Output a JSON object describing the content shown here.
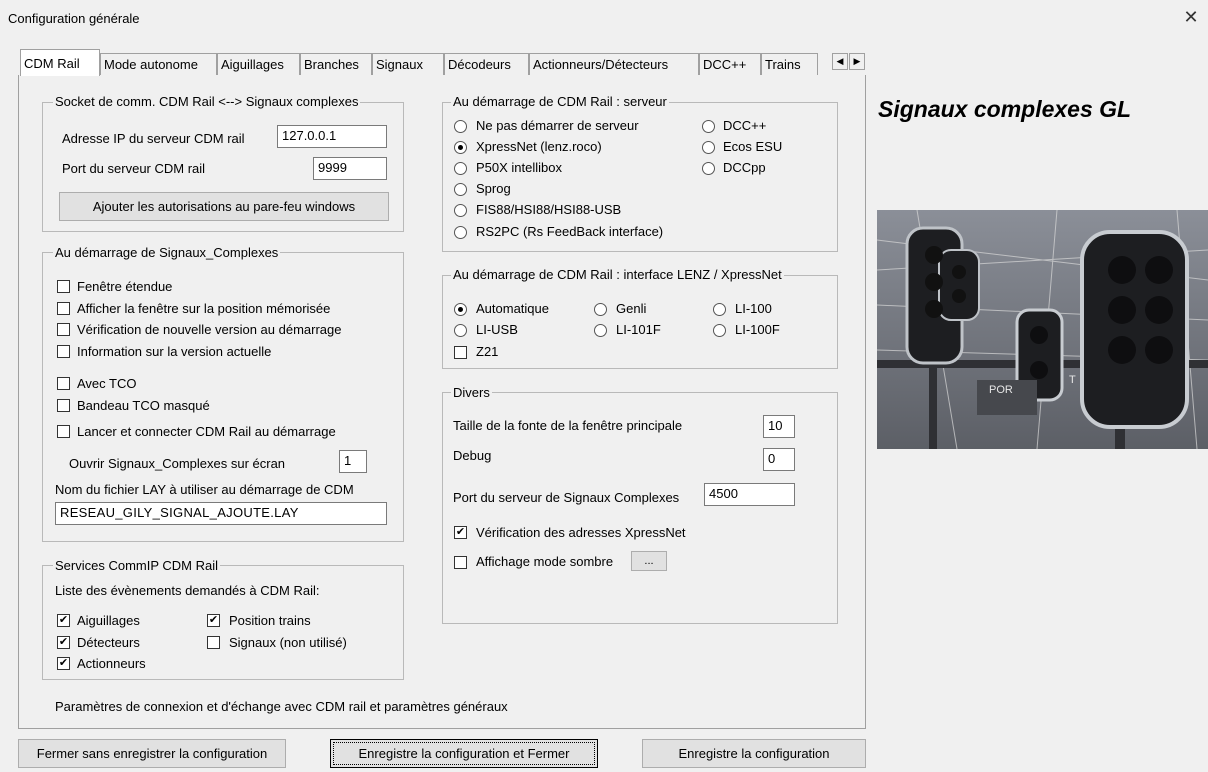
{
  "window": {
    "title": "Configuration générale",
    "close_icon": "close-icon"
  },
  "tabs": [
    {
      "label": "CDM Rail"
    },
    {
      "label": "Mode autonome"
    },
    {
      "label": "Aiguillages"
    },
    {
      "label": "Branches"
    },
    {
      "label": "Signaux"
    },
    {
      "label": "Décodeurs"
    },
    {
      "label": "Actionneurs/Détecteurs"
    },
    {
      "label": "DCC++"
    },
    {
      "label": "Trains"
    }
  ],
  "tab_scroll": {
    "left_icon": "arrow-left-icon",
    "right_icon": "arrow-right-icon"
  },
  "socket": {
    "legend": "Socket de comm. CDM Rail <--> Signaux complexes",
    "ip_label": "Adresse IP du serveur CDM rail",
    "ip_value": "127.0.0.1",
    "port_label": "Port du serveur CDM rail",
    "port_value": "9999",
    "firewall_button": "Ajouter les autorisations au pare-feu windows"
  },
  "startup_sc": {
    "legend": "Au démarrage de Signaux_Complexes",
    "options": [
      {
        "label": "Fenêtre étendue",
        "checked": false
      },
      {
        "label": "Afficher la fenêtre sur la position mémorisée",
        "checked": false
      },
      {
        "label": "Vérification de nouvelle version au démarrage",
        "checked": false
      },
      {
        "label": "Information sur la version actuelle",
        "checked": false
      },
      {
        "label": "Avec TCO",
        "checked": false
      },
      {
        "label": "Bandeau TCO masqué",
        "checked": false
      },
      {
        "label": "Lancer et connecter CDM Rail au démarrage",
        "checked": false
      }
    ],
    "screen_label": "Ouvrir Signaux_Complexes sur écran",
    "screen_value": "1",
    "lay_label": "Nom du fichier LAY à utiliser au démarrage de CDM",
    "lay_value": "RESEAU_GILY_SIGNAL_AJOUTE.LAY"
  },
  "services": {
    "legend": "Services CommIP CDM Rail",
    "intro": "Liste des évènements demandés à CDM Rail:",
    "options": [
      {
        "label": "Aiguillages",
        "checked": true
      },
      {
        "label": "Position trains",
        "checked": true
      },
      {
        "label": "Détecteurs",
        "checked": true
      },
      {
        "label": "Signaux (non utilisé)",
        "checked": false
      },
      {
        "label": "Actionneurs",
        "checked": true
      }
    ]
  },
  "footer_text": "Paramètres de connexion et d'échange avec CDM rail et paramètres généraux",
  "server": {
    "legend": "Au démarrage de CDM Rail : serveur",
    "options": [
      {
        "label": "Ne pas démarrer de serveur",
        "selected": false
      },
      {
        "label": "XpressNet (lenz.roco)",
        "selected": true
      },
      {
        "label": "P50X intellibox",
        "selected": false
      },
      {
        "label": "Sprog",
        "selected": false
      },
      {
        "label": "FIS88/HSI88/HSI88-USB",
        "selected": false
      },
      {
        "label": "RS2PC (Rs FeedBack interface)",
        "selected": false
      },
      {
        "label": "DCC++",
        "selected": false
      },
      {
        "label": "Ecos ESU",
        "selected": false
      },
      {
        "label": "DCCpp",
        "selected": false
      }
    ]
  },
  "lenz": {
    "legend": "Au démarrage de CDM Rail : interface LENZ / XpressNet",
    "options": [
      {
        "label": "Automatique",
        "selected": true
      },
      {
        "label": "Genli",
        "selected": false
      },
      {
        "label": "LI-100",
        "selected": false
      },
      {
        "label": "LI-USB",
        "selected": false
      },
      {
        "label": "LI-101F",
        "selected": false
      },
      {
        "label": "LI-100F",
        "selected": false
      }
    ],
    "z21_label": "Z21",
    "z21_checked": false
  },
  "divers": {
    "legend": "Divers",
    "font_label": "Taille de la fonte de la fenêtre principale",
    "font_value": "10",
    "debug_label": "Debug",
    "debug_value": "0",
    "port_label": "Port du serveur de Signaux Complexes",
    "port_value": "4500",
    "verify_label": "Vérification des adresses XpressNet",
    "verify_checked": true,
    "dark_label": "Affichage mode sombre",
    "dark_checked": false,
    "dots_button": "..."
  },
  "brand_title": "Signaux complexes GL",
  "photo": {
    "text_por": "POR",
    "text_t": "T"
  },
  "buttons": {
    "close_no_save": "Fermer sans enregistrer la configuration",
    "save_close": "Enregistre la configuration et Fermer",
    "save": "Enregistre la configuration"
  },
  "colors": {
    "window_bg": "#f0f0f0",
    "group_border": "#b9b9b9",
    "button_bg": "#e1e1e1"
  }
}
